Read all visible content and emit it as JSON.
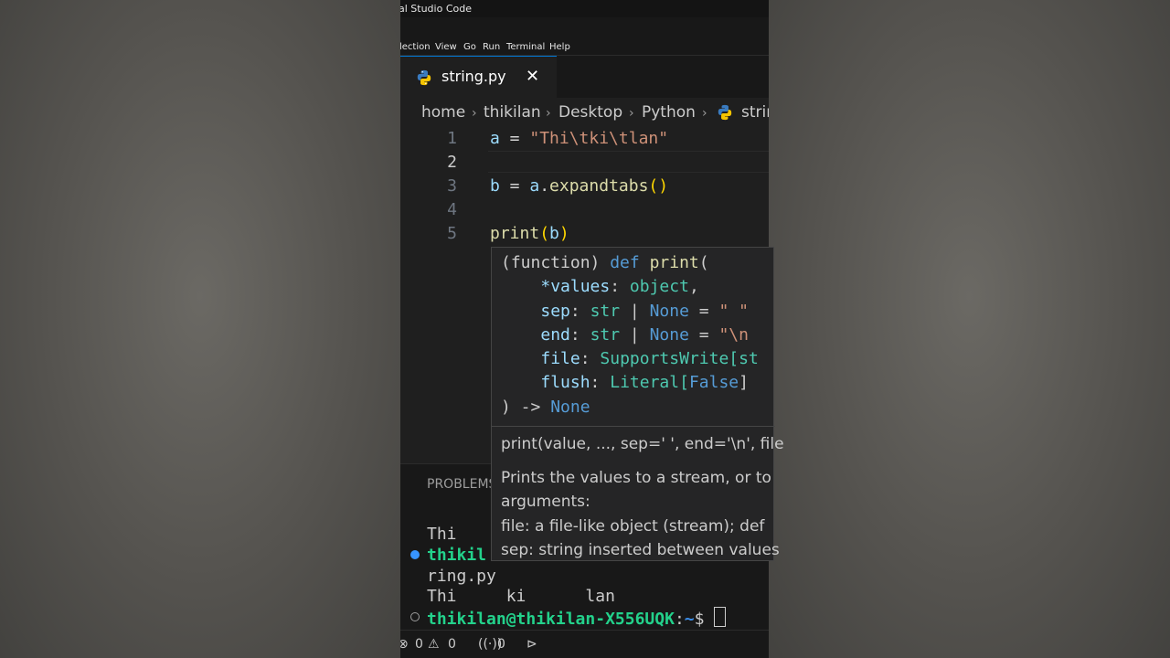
{
  "window": {
    "title": "al Studio Code"
  },
  "menu": [
    "lection",
    "View",
    "Go",
    "Run",
    "Terminal",
    "Help"
  ],
  "tab": {
    "filename": "string.py",
    "close_glyph": "✕",
    "icon": "python-icon"
  },
  "breadcrumb": {
    "parts": [
      "home",
      "thikilan",
      "Desktop",
      "Python",
      "strin"
    ],
    "separator": "›"
  },
  "editor": {
    "line_numbers": [
      "1",
      "2",
      "3",
      "4",
      "5"
    ],
    "active_line": "2",
    "lines": [
      {
        "var": "a",
        "op": " = ",
        "str": "\"Thi\\tki\\tlan\""
      },
      {},
      {
        "var": "b",
        "op": " = ",
        "var2": "a",
        "dot": ".",
        "fn": "expandtabs",
        "paren": "()"
      },
      {},
      {
        "fn": "print",
        "paren_open": "(",
        "var": "b",
        "paren_close": ")"
      }
    ]
  },
  "hover": {
    "sig_open": "(function) ",
    "def_kw": "def",
    "fn_name": " print",
    "paren": "(",
    "params": [
      {
        "indent": "    ",
        "name": "*values",
        "colon": ": ",
        "type": "object",
        "rest": ","
      },
      {
        "indent": "    ",
        "name": "sep",
        "colon": ": ",
        "type": "str",
        "pipe": " | ",
        "none": "None",
        "eq": " = ",
        "default": "\" \""
      },
      {
        "indent": "    ",
        "name": "end",
        "colon": ": ",
        "type": "str",
        "pipe": " | ",
        "none": "None",
        "eq": " = ",
        "default": "\"\\n"
      },
      {
        "indent": "    ",
        "name": "file",
        "colon": ": ",
        "type": "SupportsWrite[st"
      },
      {
        "indent": "    ",
        "name": "flush",
        "colon": ": ",
        "type": "Literal[",
        "lit": "False",
        "rest": "]"
      }
    ],
    "close": ") -> ",
    "ret": "None",
    "doc_signature": "print(value, ..., sep=' ', end='\\n', file",
    "doc_lines": [
      "Prints the values to a stream, or to",
      "arguments:",
      "file: a file-like object (stream); def",
      "sep: string inserted between values"
    ]
  },
  "panel": {
    "tab": "PROBLEMS",
    "terminal": {
      "line1": "Thi",
      "line2_user": "thikil",
      "line3": "ring.py",
      "line4": "Thi     ki      lan",
      "prompt_user": "thikilan@thikilan-X556UQK",
      "prompt_colon": ":",
      "prompt_path": "~",
      "prompt_symbol": "$ "
    }
  },
  "status": {
    "errors": "0",
    "warnings": "0",
    "ports": "0"
  },
  "colors": {
    "accent": "#0078d4",
    "terminal_user": "#23d18b",
    "terminal_path": "#3b8eea"
  }
}
